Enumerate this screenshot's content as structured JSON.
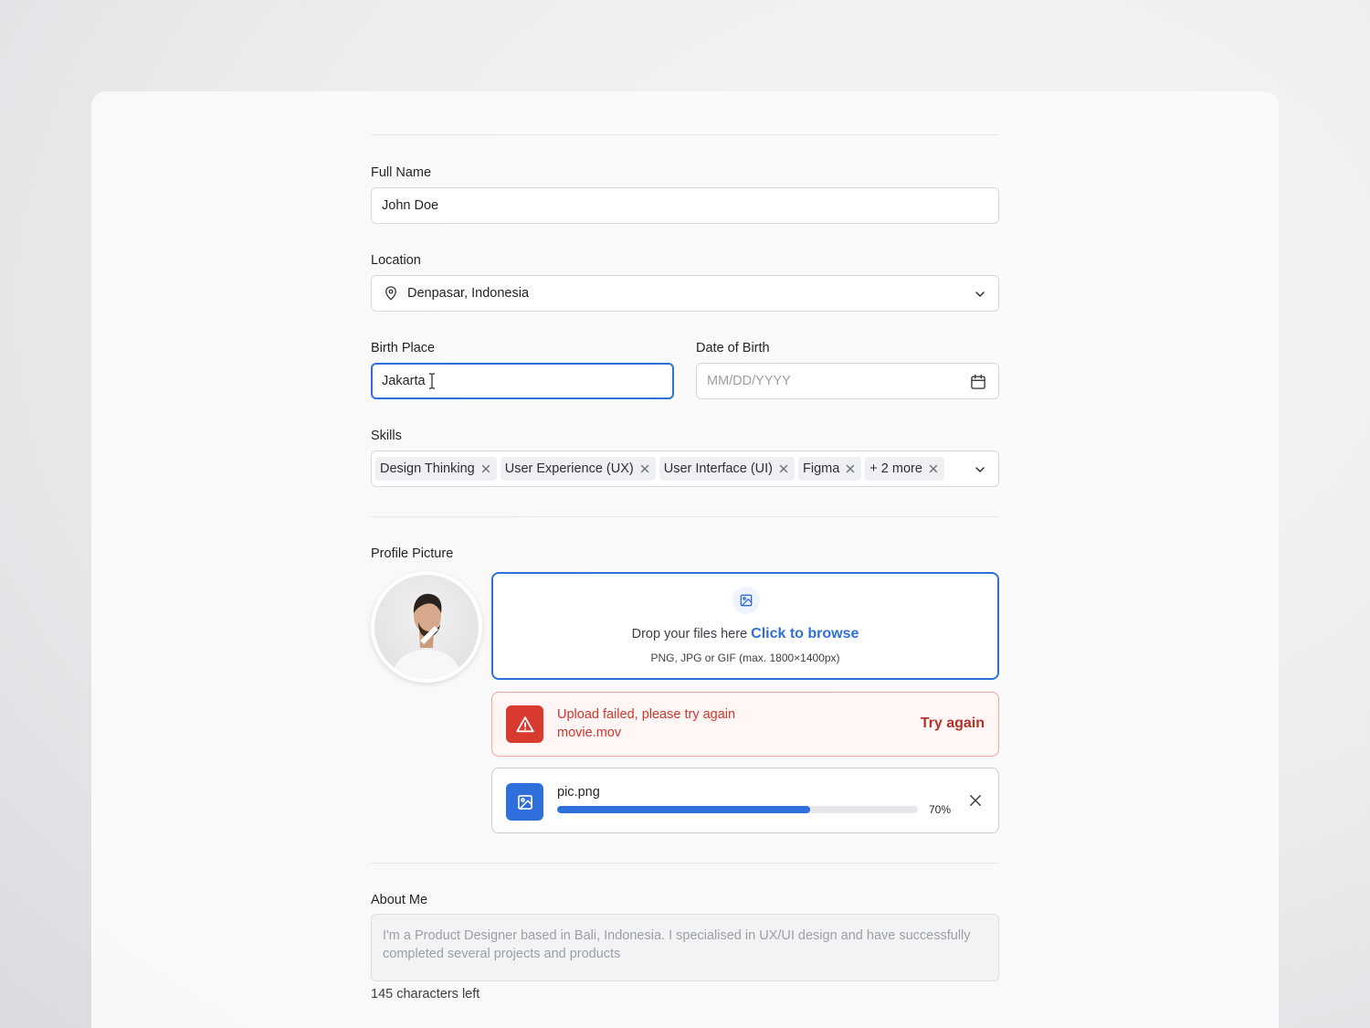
{
  "form": {
    "full_name": {
      "label": "Full Name",
      "value": "John Doe"
    },
    "location": {
      "label": "Location",
      "value": "Denpasar, Indonesia",
      "icon": "map-pin-icon"
    },
    "birth_place": {
      "label": "Birth Place",
      "value": "Jakarta"
    },
    "date_of_birth": {
      "label": "Date of Birth",
      "placeholder": "MM/DD/YYYY",
      "icon": "calendar-icon"
    },
    "skills": {
      "label": "Skills",
      "tags": [
        "Design Thinking",
        "User Experience (UX)",
        "User Interface (UI)",
        "Figma",
        "+ 2 more"
      ]
    },
    "profile_picture": {
      "label": "Profile Picture",
      "dropzone": {
        "text": "Drop your files here",
        "link": "Click to browse",
        "hint": "PNG, JPG or GIF (max. 1800×1400px)"
      },
      "error": {
        "title": "Upload failed, please try again",
        "file": "movie.mov",
        "action": "Try again"
      },
      "upload": {
        "file": "pic.png",
        "progress": 0.7,
        "progress_label": "70%"
      }
    },
    "about_me": {
      "label": "About Me",
      "placeholder": "I'm a Product Designer based in Bali, Indonesia. I specialised in UX/UI design and have successfully completed several projects and products",
      "counter": "145 characters left"
    }
  },
  "colors": {
    "accent": "#2f6fdc",
    "error": "#d93a2f",
    "error_text": "#d0362b"
  }
}
